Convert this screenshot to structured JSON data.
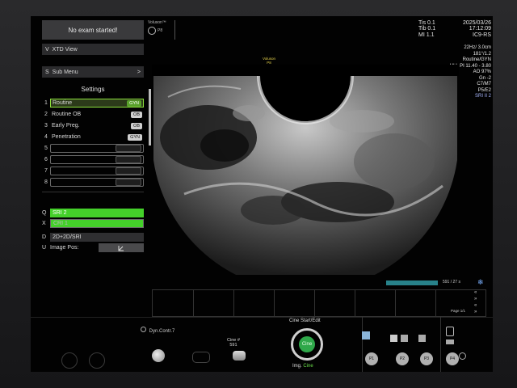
{
  "left_panel": {
    "exam_status": "No exam started!",
    "xtd_key": "V",
    "xtd_label": "XTD View",
    "submenu_key": "S",
    "submenu_label": "Sub Menu",
    "submenu_arrow": ">",
    "settings_title": "Settings",
    "settings": [
      {
        "num": "1",
        "label": "Routine",
        "tag": "GYN"
      },
      {
        "num": "2",
        "label": "Routine OB",
        "tag": "OB"
      },
      {
        "num": "3",
        "label": "Early Preg.",
        "tag": "OB"
      },
      {
        "num": "4",
        "label": "Penetration",
        "tag": "GYN"
      },
      {
        "num": "5",
        "label": "",
        "tag": ""
      },
      {
        "num": "6",
        "label": "",
        "tag": ""
      },
      {
        "num": "7",
        "label": "",
        "tag": ""
      },
      {
        "num": "8",
        "label": "",
        "tag": ""
      }
    ],
    "sri_key": "Q",
    "sri_label": "SRI 2",
    "cri_key": "X",
    "cri_label": "CRI 1",
    "dual_key": "D",
    "dual_label": "2D+2D/SRI",
    "imagepos_key": "U",
    "imagepos_label": "Image Pos:"
  },
  "header": {
    "brand": "Voluson™",
    "probe": "P8",
    "tis_label": "Tis",
    "tis_value": "0.1",
    "tib_label": "Tib",
    "tib_value": "0.1",
    "mi_label": "MI",
    "mi_value": "1.1",
    "date": "2025/03/26",
    "time": "17:12:09",
    "probe_model": "IC9-RS"
  },
  "params": [
    "22Hz/ 3.0cm",
    "181°/1.2",
    "Routine/GYN",
    "HI L PI 11.40 - 3.80",
    "AO 97%",
    "Gn -2",
    "C7/M7",
    "P5/E2",
    "SRI II 2"
  ],
  "orientation": {
    "brand": "Voluson",
    "probe": "P8"
  },
  "cine": {
    "count": "591 / 27 s",
    "page": "Page 1/1",
    "dyn_label": "Dyn.Contr.7",
    "cine_hash_label": "Cine #",
    "cine_hash_value": "591",
    "start_edit": "Cine Start/Edit",
    "dial_label": "Cine",
    "img_label": "Img.",
    "img_mode": "Cine"
  },
  "bottom_buttons": [
    "P1",
    "P2",
    "P3",
    "P4"
  ],
  "colors": {
    "accent_green": "#44d02a",
    "cine_progress": "#28828a",
    "orientation_yellow": "#e8d44c"
  }
}
